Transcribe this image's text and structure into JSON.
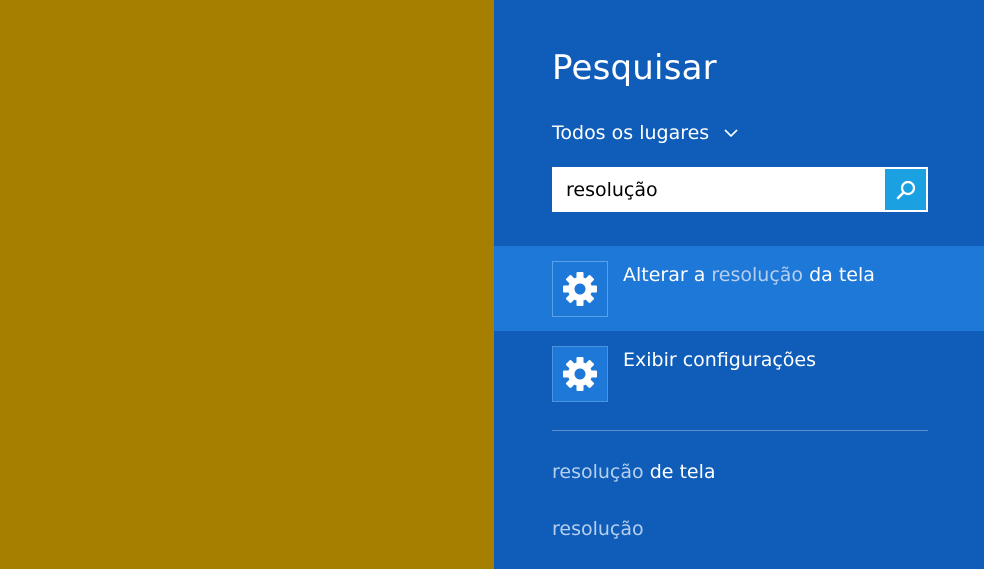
{
  "charm": {
    "title": "Pesquisar",
    "scope_label": "Todos os lugares",
    "search_value": "resolução",
    "results": [
      {
        "prefix": "Alterar a ",
        "match": "resolução",
        "suffix": " da tela",
        "icon": "gear-icon"
      },
      {
        "prefix": "Exibir configurações",
        "match": "",
        "suffix": "",
        "icon": "gear-icon"
      }
    ],
    "suggestions": [
      {
        "match": "resolução",
        "rest": " de tela"
      },
      {
        "match": "resolução",
        "rest": ""
      }
    ]
  },
  "colors": {
    "desktop": "#a77f00",
    "charm_bg": "#0f5db8",
    "selected_bg": "#1e78d7",
    "search_button": "#1ba1e2",
    "highlight_text": "#b6cff0"
  }
}
